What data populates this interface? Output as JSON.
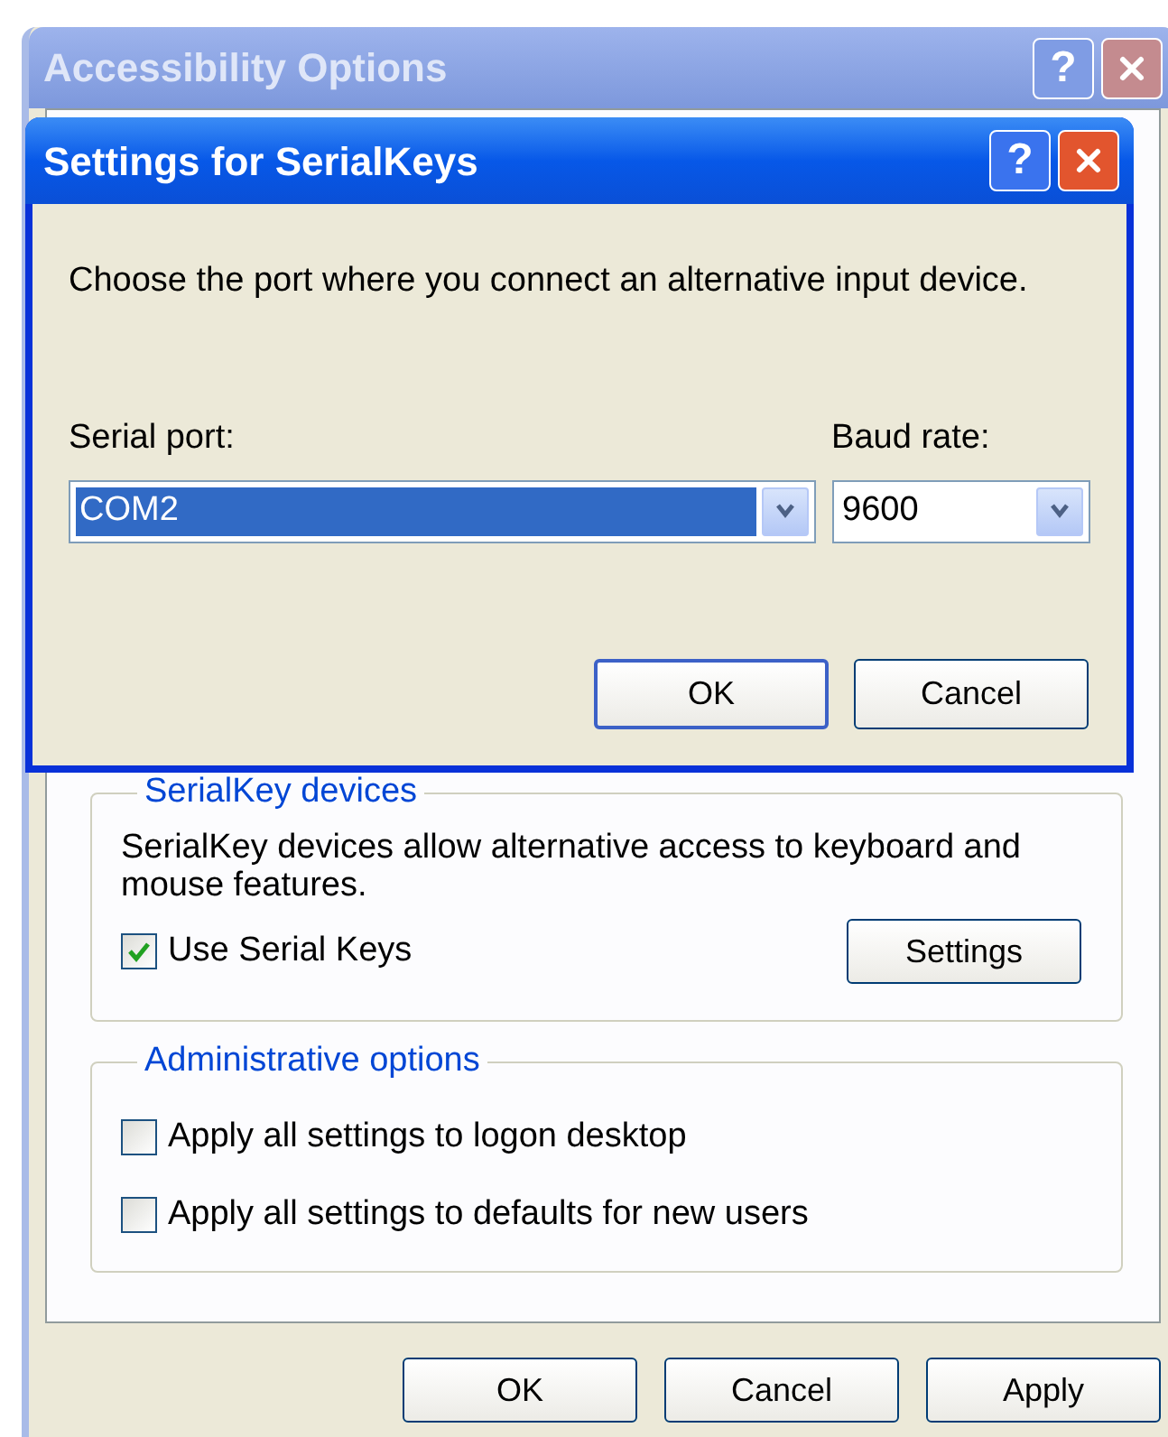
{
  "window": {
    "title": "Accessibility Options",
    "active": false,
    "help_button": "?",
    "serialkey_group": {
      "label": "SerialKey devices",
      "description": "SerialKey devices allow alternative access to keyboard and mouse features.",
      "checkbox": {
        "label": "Use Serial Keys",
        "checked": true
      },
      "button": "Settings"
    },
    "admin_group": {
      "label": "Administrative options",
      "checkboxes": [
        {
          "label": "Apply all settings to logon desktop",
          "checked": false
        },
        {
          "label": "Apply all settings to defaults for new users",
          "checked": false
        }
      ]
    },
    "buttons": [
      "OK",
      "Cancel",
      "Apply"
    ]
  },
  "dialog": {
    "title": "Settings for SerialKeys",
    "active": true,
    "help_button": "?",
    "instruction": "Choose the port where you connect an alternative input device.",
    "fields": [
      {
        "label": "Serial port:",
        "value": "COM2",
        "highlighted": true
      },
      {
        "label": "Baud rate:",
        "value": "9600",
        "highlighted": false
      }
    ],
    "buttons": [
      {
        "label": "OK",
        "default": true
      },
      {
        "label": "Cancel",
        "default": false
      }
    ]
  }
}
